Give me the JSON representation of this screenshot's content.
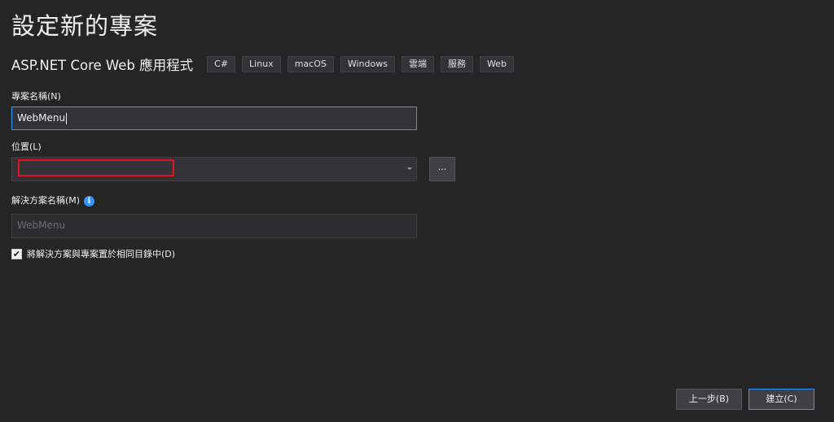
{
  "title": "設定新的專案",
  "template": {
    "name": "ASP.NET Core Web 應用程式",
    "tags": [
      "C#",
      "Linux",
      "macOS",
      "Windows",
      "雲端",
      "服務",
      "Web"
    ]
  },
  "project_name": {
    "label": "專案名稱(N)",
    "value": "WebMenu"
  },
  "location": {
    "label": "位置(L)",
    "value": "",
    "browse_label": "..."
  },
  "solution_name": {
    "label": "解決方案名稱(M)",
    "placeholder": "WebMenu",
    "info_glyph": "i"
  },
  "same_dir_checkbox": {
    "label": "將解決方案與專案置於相同目錄中(D)",
    "checked": true,
    "check_glyph": "✔"
  },
  "buttons": {
    "back": "上一步(B)",
    "create": "建立(C)"
  },
  "colors": {
    "background": "#252526",
    "accent": "#3399ff",
    "redaction": "#e81123",
    "info_icon": "#3794ff"
  }
}
